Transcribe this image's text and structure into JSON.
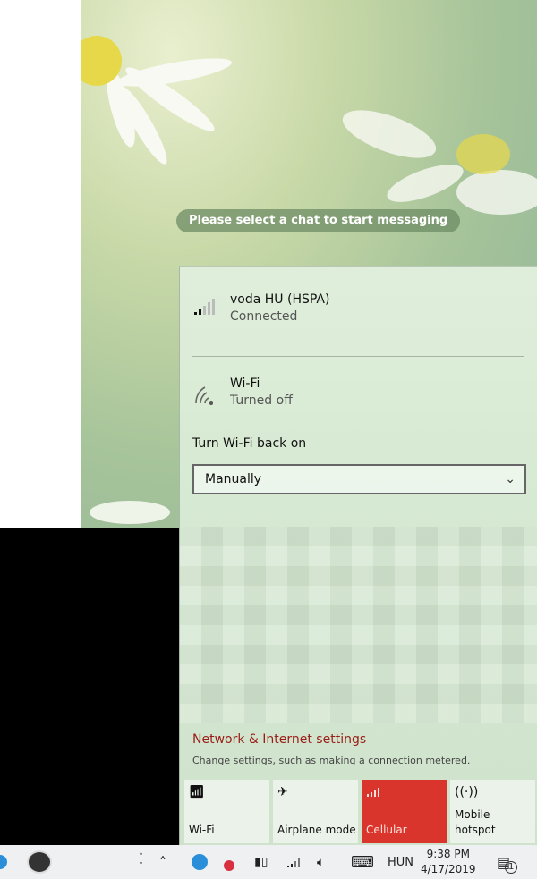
{
  "chat": {
    "placeholder": "Please select a chat to start messaging"
  },
  "cellular": {
    "name": "voda HU (HSPA)",
    "status": "Connected",
    "icon": "signal-bars-icon"
  },
  "wifi": {
    "name": "Wi-Fi",
    "status": "Turned off",
    "icon": "wifi-icon"
  },
  "wifi_back_on": {
    "label": "Turn Wi-Fi back on",
    "selected": "Manually"
  },
  "settings": {
    "link": "Network & Internet settings",
    "description": "Change settings, such as making a connection metered.",
    "link_color": "#9a1c16"
  },
  "quick_actions": [
    {
      "label": "Wi-Fi",
      "icon": "wifi-icon",
      "active": false
    },
    {
      "label": "Airplane mode",
      "icon": "airplane-icon",
      "active": false
    },
    {
      "label": "Cellular",
      "icon": "signal-bars-icon",
      "active": true
    },
    {
      "label": "Mobile hotspot",
      "icon": "hotspot-icon",
      "active": false
    }
  ],
  "accent": "#d9352c",
  "taskbar": {
    "language": "HUN",
    "time": "9:38 PM",
    "date": "4/17/2019",
    "notification_count": "1"
  }
}
